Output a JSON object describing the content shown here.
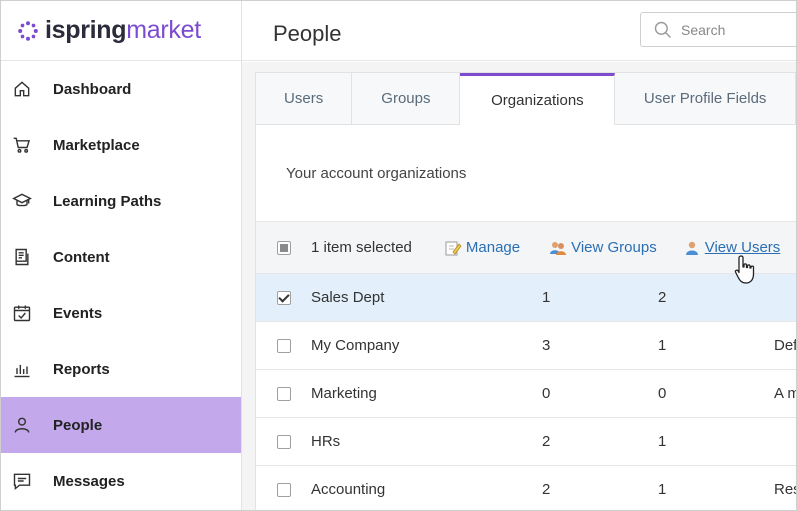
{
  "app": {
    "logo_part1": "ispring",
    "logo_part2": "market",
    "brand_color": "#7b4ccf"
  },
  "sidebar": {
    "items": [
      {
        "label": "Dashboard",
        "icon": "home-icon"
      },
      {
        "label": "Marketplace",
        "icon": "cart-icon"
      },
      {
        "label": "Learning Paths",
        "icon": "graduation-cap-icon"
      },
      {
        "label": "Content",
        "icon": "document-icon"
      },
      {
        "label": "Events",
        "icon": "calendar-check-icon"
      },
      {
        "label": "Reports",
        "icon": "bar-chart-icon"
      },
      {
        "label": "People",
        "icon": "person-icon",
        "active": true
      },
      {
        "label": "Messages",
        "icon": "message-icon"
      }
    ],
    "active_color": "#c3a8ec"
  },
  "header": {
    "title": "People",
    "search_placeholder": "Search"
  },
  "tabs": [
    {
      "label": "Users"
    },
    {
      "label": "Groups"
    },
    {
      "label": "Organizations",
      "active": true
    },
    {
      "label": "User Profile Fields"
    }
  ],
  "description": "Your account organizations",
  "toolbar": {
    "selected_text": "1 item selected",
    "manage_label": "Manage",
    "view_groups_label": "View Groups",
    "view_users_label": "View Users"
  },
  "rows": [
    {
      "name": "Sales Dept",
      "c1": "1",
      "c2": "2",
      "c3": "",
      "checked": true
    },
    {
      "name": "My Company",
      "c1": "3",
      "c2": "1",
      "c3": "Def",
      "checked": false
    },
    {
      "name": "Marketing",
      "c1": "0",
      "c2": "0",
      "c3": "A m",
      "checked": false
    },
    {
      "name": "HRs",
      "c1": "2",
      "c2": "1",
      "c3": "",
      "checked": false
    },
    {
      "name": "Accounting",
      "c1": "2",
      "c2": "1",
      "c3": "Res",
      "checked": false
    }
  ]
}
